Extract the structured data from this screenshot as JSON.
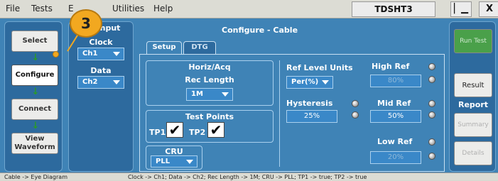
{
  "menu": {
    "file": "File",
    "tests": "Tests",
    "edit": "E",
    "utilities": "Utilities",
    "help": "Help"
  },
  "title": "TDSHT3",
  "window_buttons": {
    "minimize_glyph": "▏▁",
    "close_glyph": "X"
  },
  "nav": {
    "select": "Select",
    "configure": "Configure",
    "connect": "Connect",
    "view_waveform": "View Waveform",
    "arrow_glyph": "↓"
  },
  "input": {
    "title": "Input",
    "clock_label": "Clock",
    "clock_value": "Ch1",
    "data_label": "Data",
    "data_value": "Ch2"
  },
  "configure": {
    "title": "Configure - Cable",
    "tabs": [
      "Setup",
      "DTG"
    ],
    "horiz_acq": "Horiz/Acq",
    "rec_length_label": "Rec Length",
    "rec_length_value": "1M",
    "test_points_label": "Test Points",
    "tp1_label": "TP1",
    "tp2_label": "TP2",
    "tp1_checked": true,
    "tp2_checked": true,
    "check_glyph": "✔",
    "cru_label": "CRU",
    "cru_value": "PLL",
    "ref_level_units_label": "Ref Level Units",
    "ref_level_units_value": "Per(%)",
    "hysteresis_label": "Hysteresis",
    "hysteresis_value": "25%",
    "high_ref_label": "High Ref",
    "high_ref_value": "80%",
    "mid_ref_label": "Mid Ref",
    "mid_ref_value": "50%",
    "low_ref_label": "Low Ref",
    "low_ref_value": "20%"
  },
  "actions": {
    "run_test": "Run Test",
    "result": "Result",
    "report_label": "Report",
    "summary": "Summary",
    "details": "Details"
  },
  "status": {
    "left": "Cable -> Eye Diagram",
    "right": "Clock -> Ch1; Data -> Ch2; Rec Length -> 1M; CRU -> PLL; TP1 -> true; TP2 -> true"
  },
  "callout": {
    "number": "3"
  },
  "colors": {
    "panel_blue": "#3f83b6",
    "panel_dark": "#2d6a9e",
    "callout_orange": "#f2a820",
    "run_green": "#4aa04a"
  }
}
